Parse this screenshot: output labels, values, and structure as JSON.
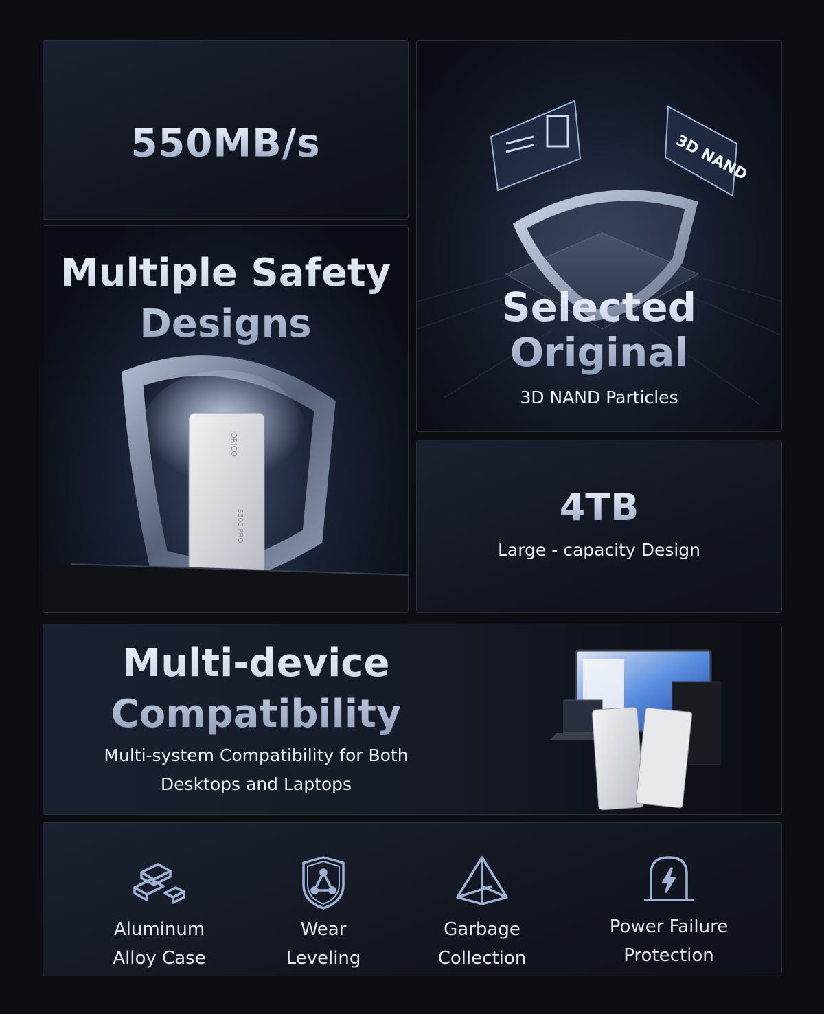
{
  "speed": {
    "value": "550MB/s"
  },
  "safety": {
    "title_line1": "Multiple Safety",
    "title_line2": "Designs",
    "drive_brand": "ORICO",
    "drive_model": "S500 PRO"
  },
  "nand": {
    "title_line1": "Selected",
    "title_line2": "Original",
    "subtitle": "3D NAND Particles",
    "chip_label": "3D NAND"
  },
  "capacity": {
    "value": "4TB",
    "subtitle": "Large - capacity Design"
  },
  "compat": {
    "title_line1": "Multi-device",
    "title_line2": "Compatibility",
    "subtitle_line1": "Multi-system Compatibility for Both",
    "subtitle_line2": "Desktops and Laptops"
  },
  "features": [
    {
      "icon": "aluminum-bars-icon",
      "line1": "Aluminum",
      "line2": "Alloy Case"
    },
    {
      "icon": "shield-network-icon",
      "line1": "Wear",
      "line2": "Leveling"
    },
    {
      "icon": "pyramid-icon",
      "line1": "Garbage",
      "line2": "Collection"
    },
    {
      "icon": "power-shield-icon",
      "line1": "Power Failure",
      "line2": "Protection"
    }
  ],
  "colors": {
    "background": "#0c0e14",
    "card": "#151a26",
    "accent": "#c9d3e6"
  }
}
